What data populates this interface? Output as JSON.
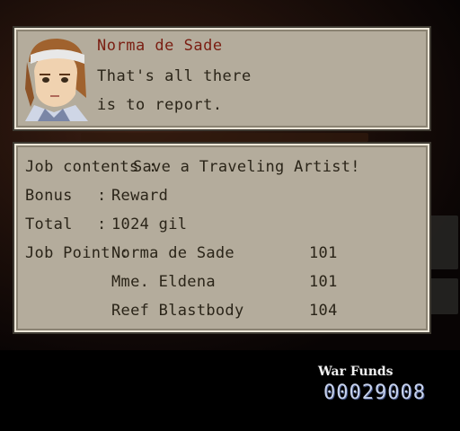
{
  "dialog": {
    "speaker": "Norma de Sade",
    "lines": [
      "That's all there",
      "is to report."
    ]
  },
  "report": {
    "job_contents_label": "Job contents :",
    "job_contents_value": "Save a Traveling Artist!",
    "bonus_label": "Bonus",
    "bonus_value": "Reward",
    "total_label": "Total",
    "total_value": "1024 gil",
    "job_point_label": "Job Point :",
    "job_points": [
      {
        "name": "Norma de Sade",
        "points": "101"
      },
      {
        "name": "Mme. Eldena",
        "points": "101"
      },
      {
        "name": "Reef Blastbody",
        "points": "104"
      }
    ]
  },
  "war_funds": {
    "label": "War Funds",
    "value": "00029008"
  },
  "colors": {
    "panel_bg": "#b4ac9c",
    "speaker_name": "#7a1e12",
    "funds_digits": "#c7d2ec"
  }
}
